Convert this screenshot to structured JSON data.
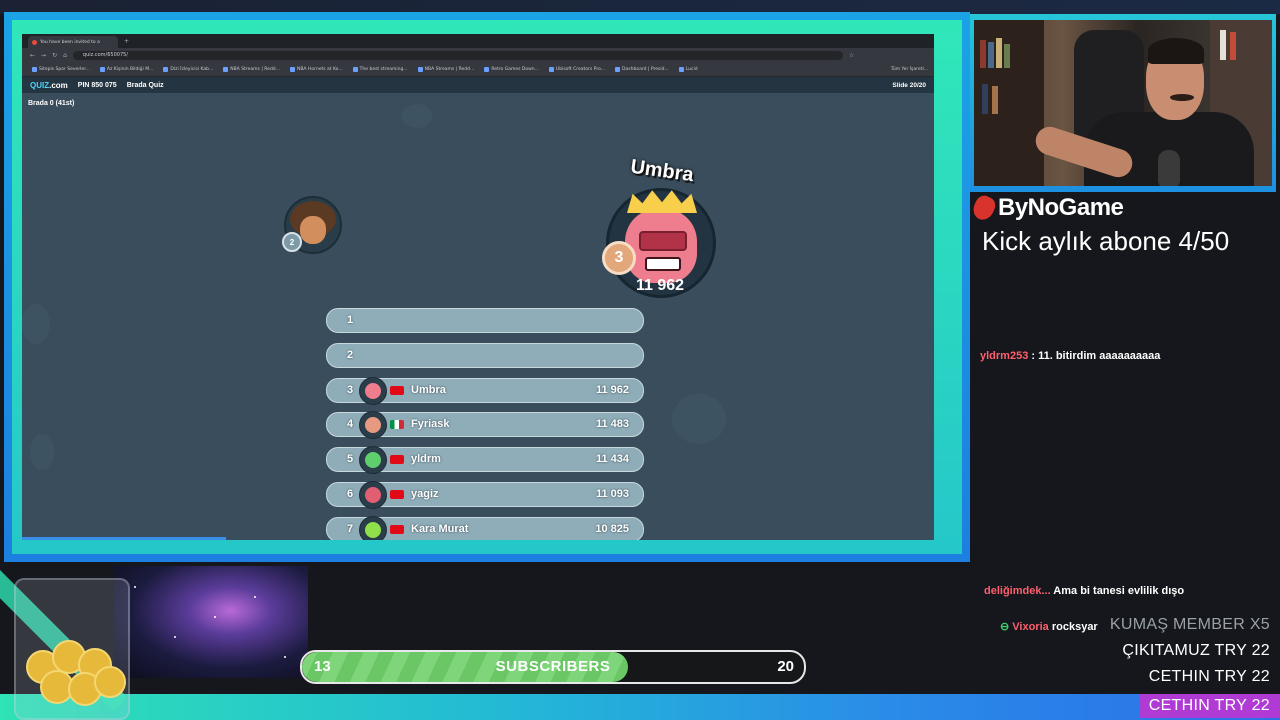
{
  "browser": {
    "tab_title": "You have been invited to a",
    "url": "quiz.com/650075/",
    "bookmarks": [
      "Sitepis Spor Severler...",
      "Az Kişinin Bildiği M...",
      "Dizi İzleyicisi Kab...",
      "NBA Streams | Redd...",
      "NBA Hornets at Ko...",
      "The best streaming...",
      "NBA Streams | Redd...",
      "Retro Games Down...",
      "Ubisoft Creators Pro...",
      "Dashboard | Presid...",
      "Lucid"
    ],
    "right_bookmark": "Tüm Yer İşaretl..."
  },
  "quiz": {
    "logo_main": "QUIZ",
    "logo_suffix": ".com",
    "pin": "PIN 850 075",
    "quiz_name": "Brada Quiz",
    "slide": "Slide 20/20",
    "user_line": "Brada    0 (41st)",
    "rank2_chip": "2",
    "podium": {
      "name": "Umbra",
      "rank": "3",
      "score": "11 962"
    },
    "leaderboard": [
      {
        "rank": "1",
        "name": "",
        "score": "",
        "flag": "",
        "avatar_color": ""
      },
      {
        "rank": "2",
        "name": "",
        "score": "",
        "flag": "",
        "avatar_color": ""
      },
      {
        "rank": "3",
        "name": "Umbra",
        "score": "11 962",
        "flag": "tr",
        "avatar_color": "#ee7d8d"
      },
      {
        "rank": "4",
        "name": "Fyriask",
        "score": "11 483",
        "flag": "it",
        "avatar_color": "#e79a82"
      },
      {
        "rank": "5",
        "name": "yldrm",
        "score": "11 434",
        "flag": "tr",
        "avatar_color": "#5fcf6d"
      },
      {
        "rank": "6",
        "name": "yagiz",
        "score": "11 093",
        "flag": "tr",
        "avatar_color": "#e25e72"
      },
      {
        "rank": "7",
        "name": "Kara Murat",
        "score": "10 825",
        "flag": "tr",
        "avatar_color": "#8fe04a"
      }
    ]
  },
  "stream": {
    "brand": "ByNoGame",
    "sub_goal_text": "Kick aylık abone 4/50",
    "chat": [
      {
        "user": "yldrm253",
        "sep": " : ",
        "msg": "11. bitirdim aaaaaaaaaa"
      },
      {
        "user": "deliğimdek...",
        "sep": " ",
        "msg": "Ama bi tanesi evlilik dışo"
      },
      {
        "user": "Vixoria",
        "sep": " ",
        "msg": "rocksyar"
      }
    ],
    "alerts": [
      "KUMAŞ   MEMBER X5",
      "ÇIKITAMUZ   TRY 22",
      "CETHIN   TRY 22",
      "CETHIN   TRY 22"
    ],
    "subscribers": {
      "current": "13",
      "label": "SUBSCRIBERS",
      "goal": "20",
      "progress_fraction": 0.65
    }
  },
  "colors": {
    "accent_teal": "#2ee3b5",
    "accent_blue": "#1d7fe0",
    "highlight_purple": "#b03ad4",
    "chat_user": "#ff5f6d"
  }
}
